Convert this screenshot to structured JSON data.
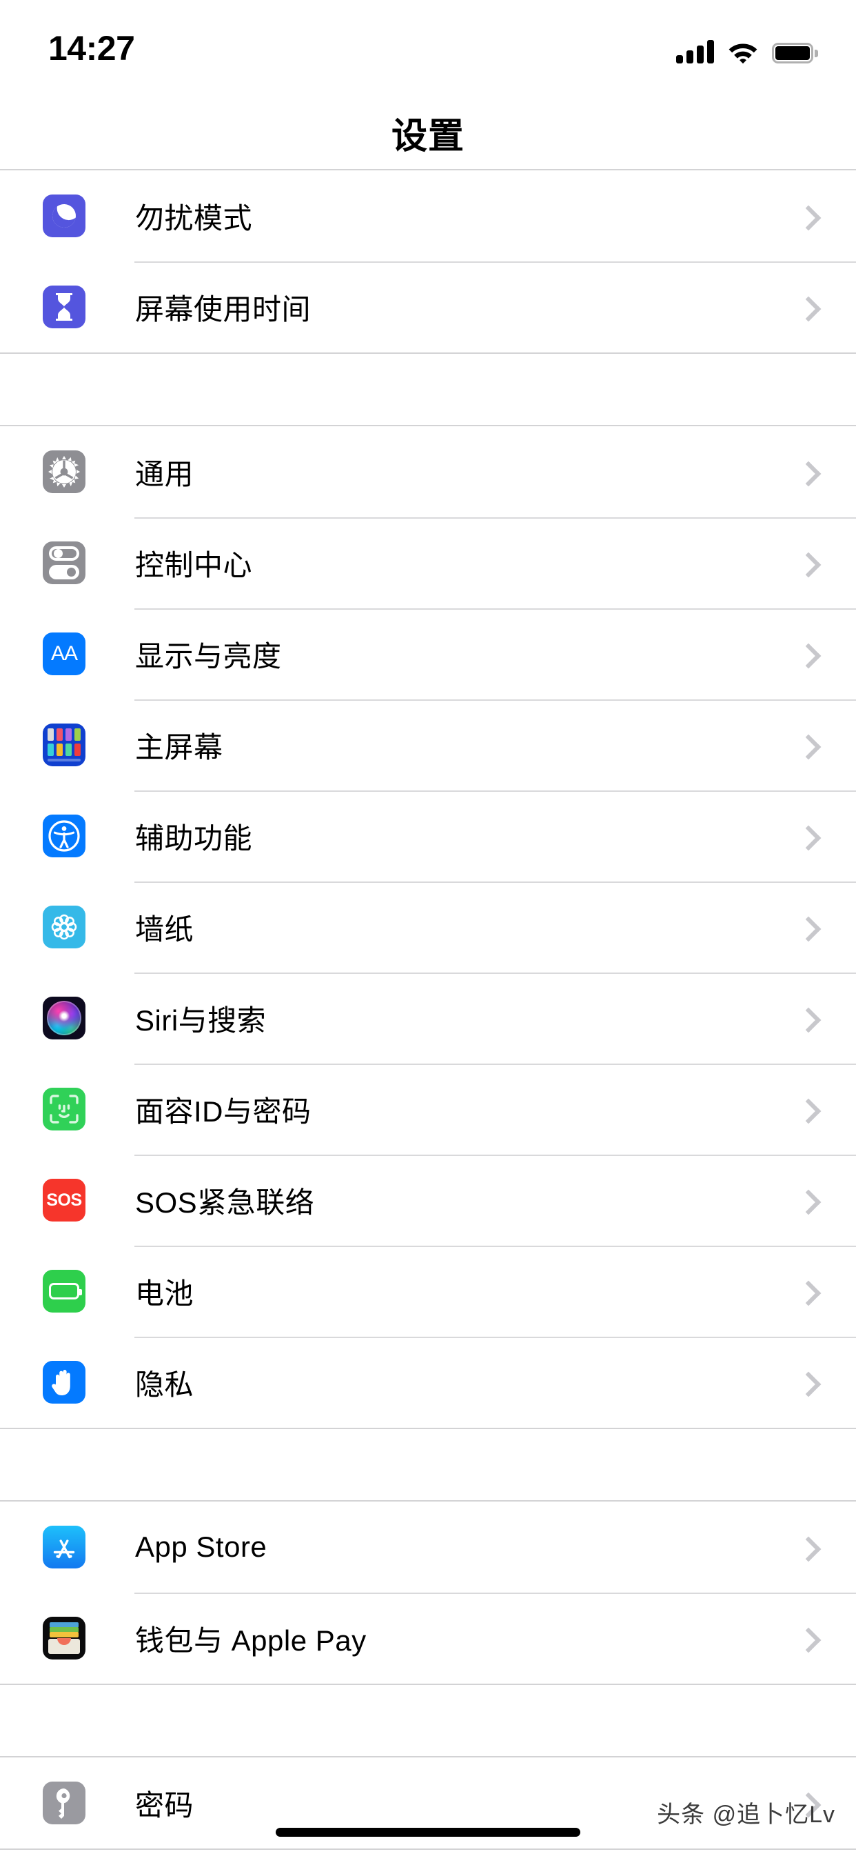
{
  "status_bar": {
    "time": "14:27",
    "signal_icon": "cellular-signal-icon",
    "wifi_icon": "wifi-icon",
    "battery_icon": "battery-full-icon"
  },
  "nav": {
    "title": "设置"
  },
  "groups": [
    {
      "id": "group-focus",
      "rows": [
        {
          "label": "勿扰模式",
          "icon": "do-not-disturb-icon",
          "icon_class": "ic-dnd"
        },
        {
          "label": "屏幕使用时间",
          "icon": "screen-time-icon",
          "icon_class": "ic-screentime"
        }
      ]
    },
    {
      "id": "group-system",
      "rows": [
        {
          "label": "通用",
          "icon": "gear-icon",
          "icon_class": "ic-general"
        },
        {
          "label": "控制中心",
          "icon": "control-center-icon",
          "icon_class": "ic-control"
        },
        {
          "label": "显示与亮度",
          "icon": "display-brightness-icon",
          "icon_class": "ic-display"
        },
        {
          "label": "主屏幕",
          "icon": "home-screen-icon",
          "icon_class": "ic-home"
        },
        {
          "label": "辅助功能",
          "icon": "accessibility-icon",
          "icon_class": "ic-access"
        },
        {
          "label": "墙纸",
          "icon": "wallpaper-icon",
          "icon_class": "ic-wallpaper"
        },
        {
          "label": "Siri与搜索",
          "icon": "siri-icon",
          "icon_class": "ic-siri"
        },
        {
          "label": "面容ID与密码",
          "icon": "face-id-icon",
          "icon_class": "ic-faceid"
        },
        {
          "label": "SOS紧急联络",
          "icon": "emergency-sos-icon",
          "icon_class": "ic-sos"
        },
        {
          "label": "电池",
          "icon": "battery-icon",
          "icon_class": "ic-battery"
        },
        {
          "label": "隐私",
          "icon": "privacy-hand-icon",
          "icon_class": "ic-privacy"
        }
      ]
    },
    {
      "id": "group-store",
      "rows": [
        {
          "label": "App Store",
          "icon": "app-store-icon",
          "icon_class": "ic-appstore"
        },
        {
          "label": "钱包与 Apple Pay",
          "icon": "wallet-icon",
          "icon_class": "ic-wallet"
        }
      ]
    },
    {
      "id": "group-accounts",
      "rows": [
        {
          "label": "密码",
          "icon": "key-icon",
          "icon_class": "ic-passwords"
        }
      ]
    }
  ],
  "chevron_icon": "chevron-right-icon",
  "watermark": {
    "text": "头条 @追卜忆Lv"
  },
  "home_indicator": "home-indicator",
  "colors": {
    "background": "#ffffff",
    "separator": "#d9d9db",
    "group_border": "#d3d3d5",
    "chevron": "#c8c8cc",
    "label_text": "#000000",
    "purple": "#5455de",
    "gray": "#8e8e93",
    "blue": "#047aff",
    "green": "#30d158",
    "red": "#f6352b",
    "cyan": "#35b9e8"
  }
}
